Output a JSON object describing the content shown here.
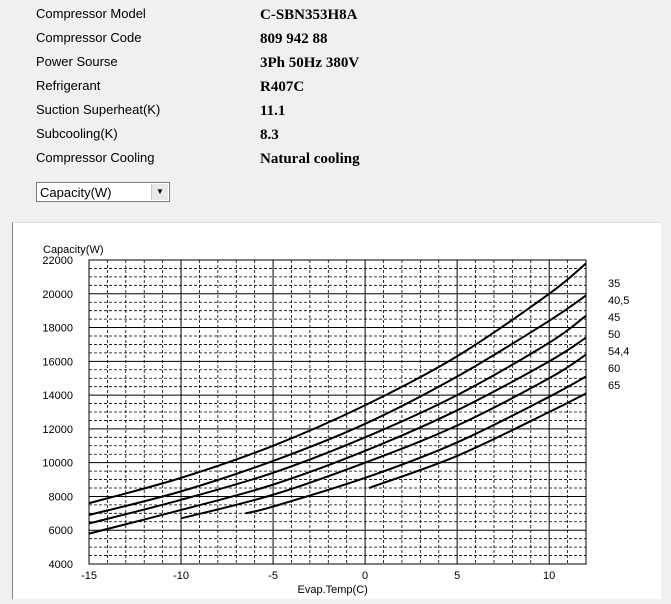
{
  "info": [
    {
      "label": "Compressor  Model",
      "value": "C-SBN353H8A"
    },
    {
      "label": "Compressor Code",
      "value": "809 942 88"
    },
    {
      "label": "Power Sourse",
      "value": "3Ph  50Hz  380V"
    },
    {
      "label": "Refrigerant",
      "value": "R407C"
    },
    {
      "label": "Suction Superheat(K)",
      "value": "11.1"
    },
    {
      "label": "Subcooling(K)",
      "value": "8.3"
    },
    {
      "label": "Compressor Cooling",
      "value": "Natural cooling"
    }
  ],
  "selector": {
    "value": "Capacity(W)",
    "icon": "chevron-down-icon"
  },
  "chart_data": {
    "type": "line",
    "xlabel": "Evap.Temp(C)",
    "ylabel": "Capacity(W)",
    "xlim": [
      -15,
      12
    ],
    "ylim": [
      4000,
      22000
    ],
    "xticks": [
      -15,
      -10,
      -5,
      0,
      5,
      10
    ],
    "yticks": [
      4000,
      6000,
      8000,
      10000,
      12000,
      14000,
      16000,
      18000,
      20000,
      22000
    ],
    "grid": true,
    "legend_position": "right",
    "series": [
      {
        "name": "35",
        "x": [
          -15,
          -10,
          -5,
          0,
          5,
          10,
          12
        ],
        "y": [
          7600,
          9100,
          11000,
          13400,
          16300,
          20000,
          21800
        ]
      },
      {
        "name": "40,5",
        "x": [
          -15,
          -10,
          -5,
          0,
          5,
          10,
          12
        ],
        "y": [
          6900,
          8300,
          10100,
          12300,
          15100,
          18400,
          19900
        ]
      },
      {
        "name": "45",
        "x": [
          -15,
          -10,
          -5,
          0,
          5,
          10,
          12
        ],
        "y": [
          6400,
          7800,
          9400,
          11500,
          14000,
          17100,
          18700
        ]
      },
      {
        "name": "50",
        "x": [
          -15,
          -10,
          -5,
          0,
          5,
          10,
          12
        ],
        "y": [
          5800,
          7200,
          8700,
          10700,
          13100,
          16000,
          17400
        ]
      },
      {
        "name": "54,4",
        "x": [
          -10,
          -5,
          0,
          5,
          10,
          12
        ],
        "y": [
          6700,
          8100,
          10000,
          12200,
          15000,
          16400
        ]
      },
      {
        "name": "60",
        "x": [
          -6.5,
          -5,
          0,
          5,
          10,
          12
        ],
        "y": [
          7000,
          7400,
          9100,
          11200,
          13900,
          15100
        ]
      },
      {
        "name": "65",
        "x": [
          0.2,
          5,
          10,
          12
        ],
        "y": [
          8500,
          10400,
          13000,
          14100
        ]
      }
    ]
  }
}
